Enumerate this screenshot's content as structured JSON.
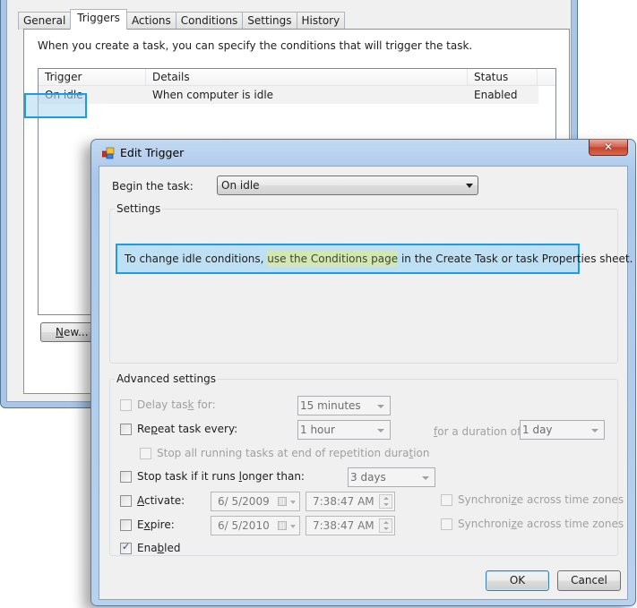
{
  "background_window": {
    "tabs": [
      {
        "label": "General",
        "active": false
      },
      {
        "label": "Triggers",
        "active": true
      },
      {
        "label": "Actions",
        "active": false
      },
      {
        "label": "Conditions",
        "active": false
      },
      {
        "label": "Settings",
        "active": false
      },
      {
        "label": "History",
        "active": false
      }
    ],
    "description": "When you create a task, you can specify the conditions that will trigger the task.",
    "trigger_list": {
      "columns": [
        "Trigger",
        "Details",
        "Status"
      ],
      "rows": [
        {
          "trigger": "On idle",
          "details": "When computer is idle",
          "status": "Enabled"
        }
      ]
    },
    "new_button": {
      "mnemonic": "N",
      "rest": "ew..."
    }
  },
  "dialog": {
    "title": "Edit Trigger",
    "close_label": "✕",
    "begin_task_label": "Begin the task:",
    "begin_task_value": "On idle",
    "settings_group_label": "Settings",
    "info": {
      "prefix": "To change idle conditions, ",
      "highlight": "use the Conditions page",
      "suffix": " in the Create Task or task Properties sheet."
    },
    "advanced_group_label": "Advanced settings",
    "delay": {
      "label_a": "Delay tas",
      "mnemonic": "k",
      "label_b": " for:",
      "value": "15 minutes",
      "checked": false,
      "enabled": false
    },
    "repeat": {
      "label_a": "Re",
      "mnemonic": "p",
      "label_b": "eat task every:",
      "value": "1 hour",
      "checked": false
    },
    "duration": {
      "mnemonic": "f",
      "label_b": "or a duration of:",
      "value": "1 day"
    },
    "stop_all": {
      "label_a": "Stop all running tasks at end of repetition dura",
      "mnemonic": "t",
      "label_b": "ion",
      "checked": false,
      "enabled": false
    },
    "stop_longer": {
      "label_a": "Stop task if it runs ",
      "mnemonic": "l",
      "label_b": "onger than:",
      "value": "3 days",
      "checked": false
    },
    "activate": {
      "mnemonic": "A",
      "label_b": "ctivate:",
      "date": "6/  5/2009",
      "time": "7:38:47 AM",
      "checked": false
    },
    "expire": {
      "label_a": "E",
      "mnemonic": "x",
      "label_b": "pire:",
      "date": "6/  5/2010",
      "time": "7:38:47 AM",
      "checked": false
    },
    "sync1": {
      "label_a": "Synchroni",
      "mnemonic": "z",
      "label_b": "e across time zones",
      "checked": false,
      "enabled": false
    },
    "sync2": {
      "label_a": "Synchroni",
      "mnemonic": "z",
      "label_b": "e across time zones",
      "checked": false,
      "enabled": false
    },
    "enabled": {
      "label_a": "Ena",
      "mnemonic": "b",
      "label_b": "led",
      "checked": true
    },
    "ok_label": "OK",
    "cancel_label": "Cancel"
  }
}
